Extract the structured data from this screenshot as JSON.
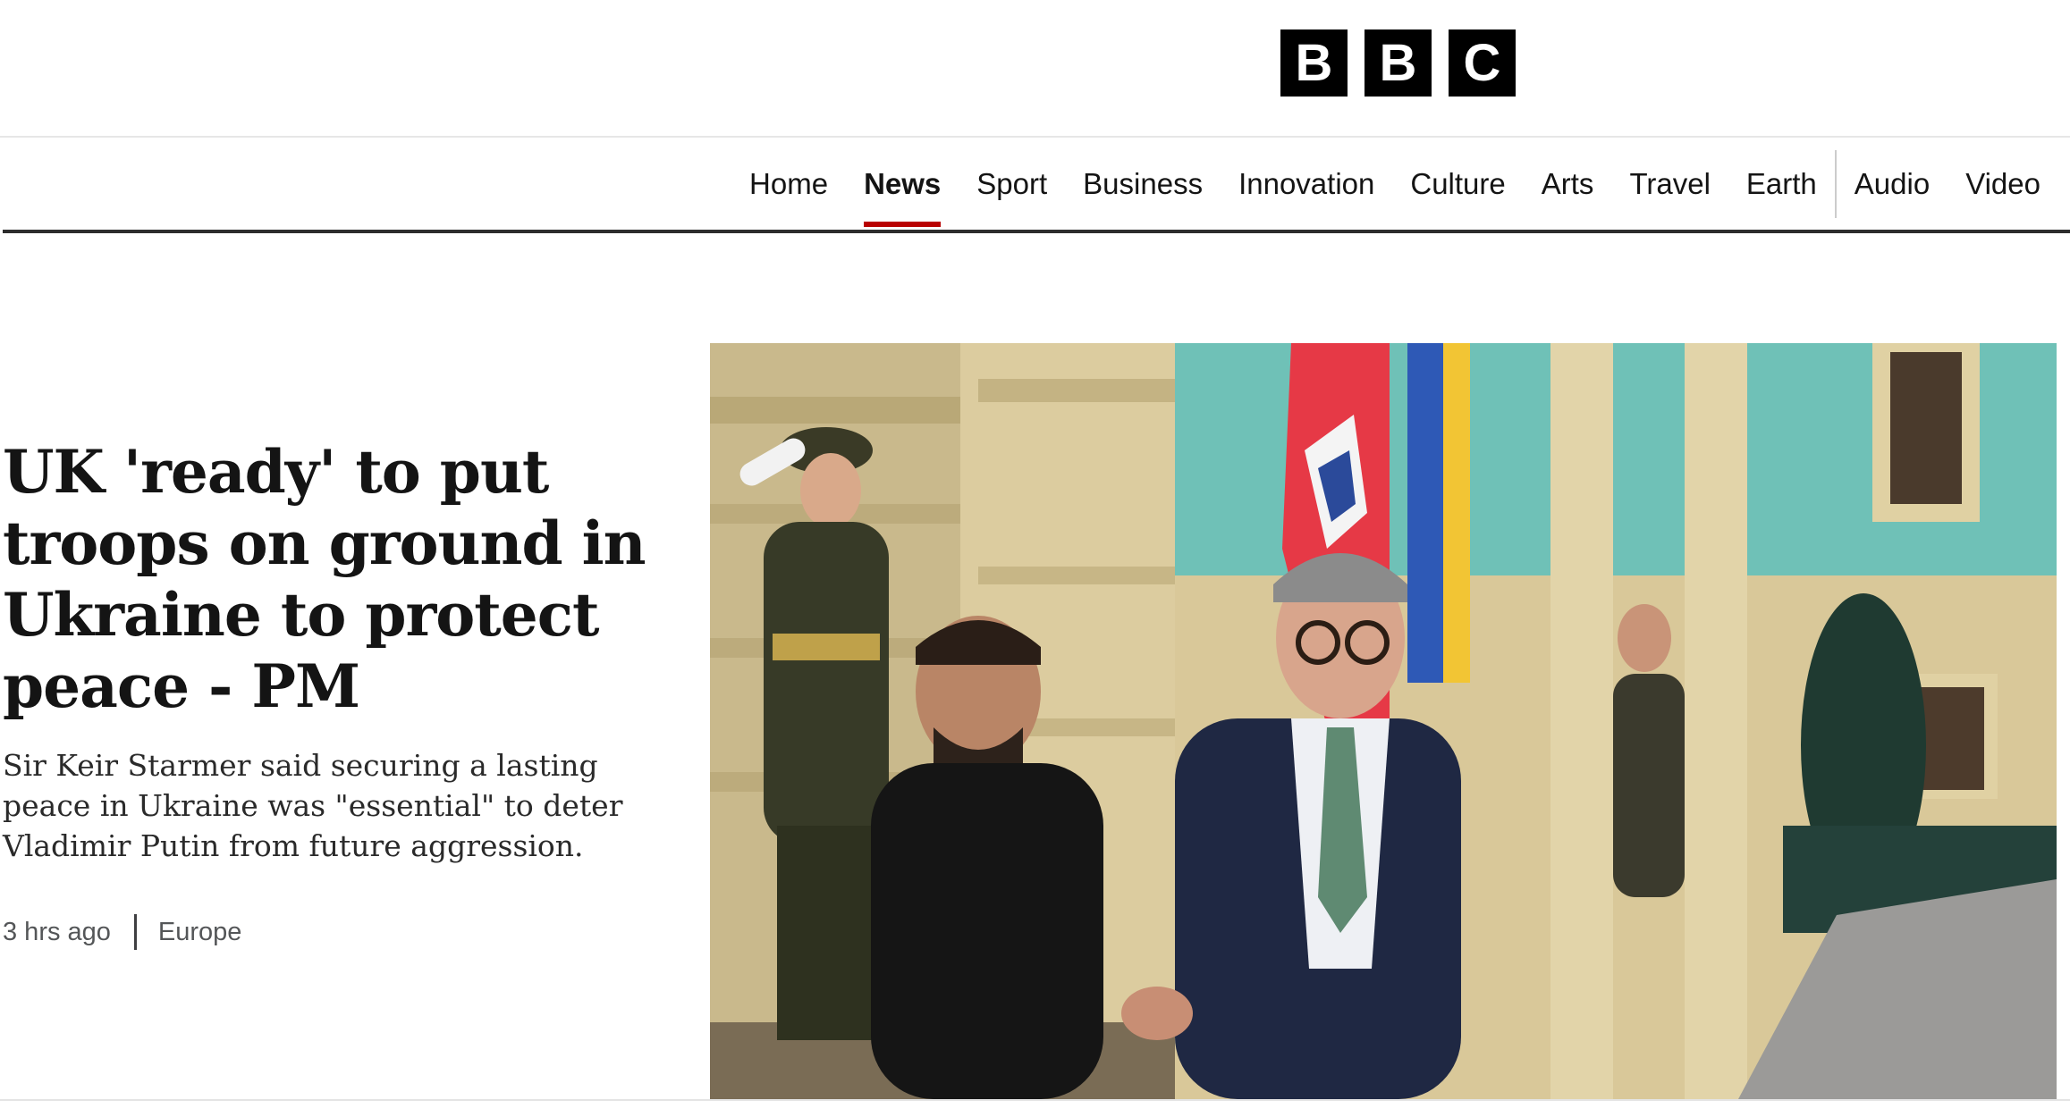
{
  "masthead": {
    "logo_letters": [
      "B",
      "B",
      "C"
    ]
  },
  "nav": {
    "items": [
      {
        "label": "Home",
        "active": false
      },
      {
        "label": "News",
        "active": true
      },
      {
        "label": "Sport",
        "active": false
      },
      {
        "label": "Business",
        "active": false
      },
      {
        "label": "Innovation",
        "active": false
      },
      {
        "label": "Culture",
        "active": false
      },
      {
        "label": "Arts",
        "active": false
      },
      {
        "label": "Travel",
        "active": false
      },
      {
        "label": "Earth",
        "active": false
      },
      {
        "label": "Audio",
        "active": false
      },
      {
        "label": "Video",
        "active": false
      }
    ],
    "active_indicator_color": "#b80000"
  },
  "story": {
    "headline": "UK 'ready' to put troops on ground in Ukraine to protect peace - PM",
    "summary": "Sir Keir Starmer said securing a lasting peace in Ukraine was \"essential\" to deter Vladimir Putin from future aggression.",
    "time": "3 hrs ago",
    "section": "Europe"
  }
}
